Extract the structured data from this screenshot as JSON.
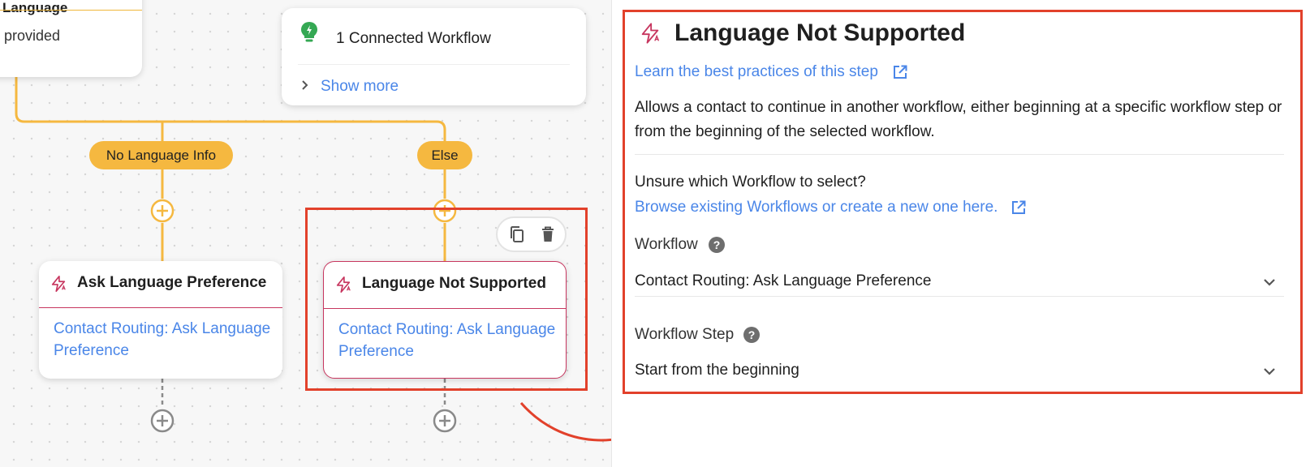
{
  "canvas": {
    "partial_card": {
      "title": "Language",
      "subtitle": "provided"
    },
    "connected": {
      "title": "1 Connected Workflow",
      "show_more": "Show more"
    },
    "branches": [
      {
        "label": "No Language Info"
      },
      {
        "label": "Else"
      }
    ],
    "nodes": [
      {
        "title": "Ask Language Preference",
        "link": "Contact Routing: Ask Language Preference"
      },
      {
        "title": "Language Not Supported",
        "link": "Contact Routing: Ask Language Preference"
      }
    ]
  },
  "panel": {
    "title": "Language Not Supported",
    "learn_link": "Learn the best practices of this step",
    "description": "Allows a contact to continue in another workflow, either beginning at a specific workflow step or from the beginning of the selected workflow.",
    "unsure": "Unsure which Workflow to select?",
    "browse_link": "Browse existing Workflows or create a new one here.",
    "workflow": {
      "label": "Workflow",
      "value": "Contact Routing: Ask Language Preference"
    },
    "workflow_step": {
      "label": "Workflow Step",
      "value": "Start from the beginning"
    }
  },
  "colors": {
    "branch": "#f5b840",
    "accent_red": "#c7365f",
    "link_blue": "#4a86e8",
    "highlight": "#e2412b",
    "bulb_green": "#34a853"
  }
}
